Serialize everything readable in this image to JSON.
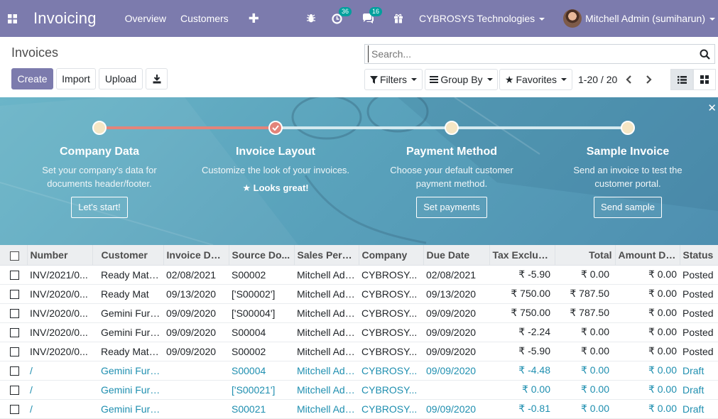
{
  "nav": {
    "app_name": "Invoicing",
    "menu": [
      "Overview",
      "Customers"
    ],
    "activity_count": "36",
    "messages_count": "16",
    "company": "CYBROSYS Technologies",
    "user": "Mitchell Admin (sumiharun)",
    "bar_color": "#7c7bad"
  },
  "control": {
    "title": "Invoices",
    "create": "Create",
    "import": "Import",
    "upload": "Upload",
    "search_placeholder": "Search...",
    "filters": "Filters",
    "group_by": "Group By",
    "favorites": "Favorites",
    "pager": "1-20 / 20"
  },
  "banner": {
    "steps": [
      {
        "title": "Company Data",
        "desc1": "Set your company's data for",
        "desc2": "documents header/footer.",
        "button": "Let's start!",
        "note": "",
        "done": false
      },
      {
        "title": "Invoice Layout",
        "desc1": "Customize the look of your invoices.",
        "desc2": "",
        "button": "",
        "note": "Looks great!",
        "done": true
      },
      {
        "title": "Payment Method",
        "desc1": "Choose your default customer",
        "desc2": "payment method.",
        "button": "Set payments",
        "note": "",
        "done": false
      },
      {
        "title": "Sample Invoice",
        "desc1": "Send an invoice to test the",
        "desc2": "customer portal.",
        "button": "Send sample",
        "note": "",
        "done": false
      }
    ]
  },
  "table": {
    "headers": [
      "Number",
      "Customer",
      "Invoice Dat...",
      "Source Do...",
      "Sales Pers...",
      "Company",
      "Due Date",
      "Tax Exclud...",
      "Total",
      "Amount Du...",
      "Status"
    ],
    "rows": [
      {
        "number": "INV/2021/0...",
        "customer": "Ready Mat, ...",
        "date": "02/08/2021",
        "source": "S00002",
        "sales": "Mitchell Admin",
        "company": "CYBROSY...",
        "due": "02/08/2021",
        "tax": "₹ -5.90",
        "total": "₹ 0.00",
        "amount": "₹ 0.00",
        "status": "Posted",
        "draft": false
      },
      {
        "number": "INV/2020/0...",
        "customer": "Ready Mat",
        "date": "09/13/2020",
        "source": "['S00002']",
        "sales": "Mitchell Admin",
        "company": "CYBROSY...",
        "due": "09/13/2020",
        "tax": "₹ 750.00",
        "total": "₹ 787.50",
        "amount": "₹ 0.00",
        "status": "Posted",
        "draft": false
      },
      {
        "number": "INV/2020/0...",
        "customer": "Gemini Furn...",
        "date": "09/09/2020",
        "source": "['S00004']",
        "sales": "Mitchell Admin",
        "company": "CYBROSY...",
        "due": "09/09/2020",
        "tax": "₹ 750.00",
        "total": "₹ 787.50",
        "amount": "₹ 0.00",
        "status": "Posted",
        "draft": false
      },
      {
        "number": "INV/2020/0...",
        "customer": "Gemini Furn...",
        "date": "09/09/2020",
        "source": "S00004",
        "sales": "Mitchell Admin",
        "company": "CYBROSY...",
        "due": "09/09/2020",
        "tax": "₹ -2.24",
        "total": "₹ 0.00",
        "amount": "₹ 0.00",
        "status": "Posted",
        "draft": false
      },
      {
        "number": "INV/2020/0...",
        "customer": "Ready Mat, ...",
        "date": "09/09/2020",
        "source": "S00002",
        "sales": "Mitchell Admin",
        "company": "CYBROSY...",
        "due": "09/09/2020",
        "tax": "₹ -5.90",
        "total": "₹ 0.00",
        "amount": "₹ 0.00",
        "status": "Posted",
        "draft": false
      },
      {
        "number": "/",
        "customer": "Gemini Furn...",
        "date": "",
        "source": "S00004",
        "sales": "Mitchell Admin",
        "company": "CYBROSY...",
        "due": "09/09/2020",
        "tax": "₹ -4.48",
        "total": "₹ 0.00",
        "amount": "₹ 0.00",
        "status": "Draft",
        "draft": true
      },
      {
        "number": "/",
        "customer": "Gemini Furn...",
        "date": "",
        "source": "['S00021']",
        "sales": "Mitchell Admin",
        "company": "CYBROSY...",
        "due": "",
        "tax": "₹ 0.00",
        "total": "₹ 0.00",
        "amount": "₹ 0.00",
        "status": "Draft",
        "draft": true
      },
      {
        "number": "/",
        "customer": "Gemini Furn...",
        "date": "",
        "source": "S00021",
        "sales": "Mitchell Admin",
        "company": "CYBROSY...",
        "due": "09/09/2020",
        "tax": "₹ -0.81",
        "total": "₹ 0.00",
        "amount": "₹ 0.00",
        "status": "Draft",
        "draft": true
      }
    ]
  }
}
